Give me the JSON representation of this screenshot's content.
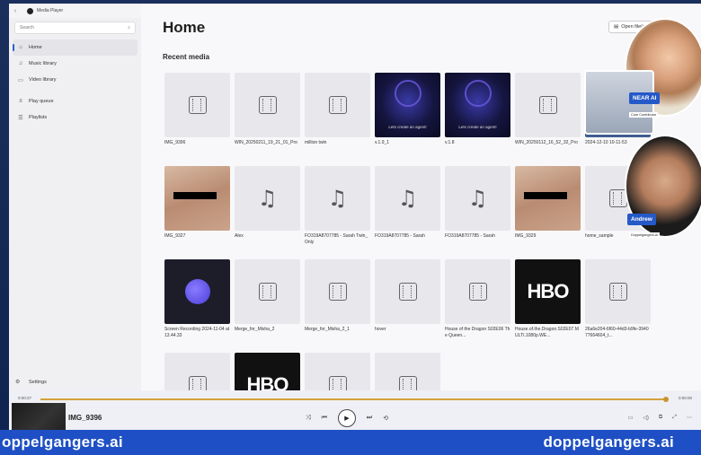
{
  "window": {
    "app_title": "Media Player",
    "back_glyph": "‹",
    "controls": [
      "—",
      "☐",
      "✕"
    ]
  },
  "sidebar": {
    "search_placeholder": "Search",
    "items": [
      {
        "label": "Home",
        "icon": "home-icon",
        "glyph": "⌂",
        "active": true
      },
      {
        "label": "Music library",
        "icon": "music-library-icon",
        "glyph": "♫"
      },
      {
        "label": "Video library",
        "icon": "video-library-icon",
        "glyph": "▭"
      },
      {
        "label": "Play queue",
        "icon": "play-queue-icon",
        "glyph": "≡"
      },
      {
        "label": "Playlists",
        "icon": "playlists-icon",
        "glyph": "☰"
      }
    ],
    "settings_label": "Settings"
  },
  "main": {
    "title": "Home",
    "open_file_label": "Open file(s)",
    "section_title": "Recent media",
    "tiles": [
      {
        "name": "IMG_9396",
        "thumb": "film"
      },
      {
        "name": "WIN_20250211_19_21_01_Pro",
        "thumb": "film"
      },
      {
        "name": "million twin",
        "thumb": "film"
      },
      {
        "name": "v.1.9_1",
        "thumb": "agent",
        "overlay": "Lets create an agent!"
      },
      {
        "name": "v.1.8",
        "thumb": "agent",
        "overlay": "Lets create an agent!"
      },
      {
        "name": "WIN_20250112_16_52_32_Pro",
        "thumb": "film"
      },
      {
        "name": "2024-12-10 10-11-53",
        "thumb": "person",
        "overlay": "Core Contributor"
      },
      {
        "name": "IMG_9327",
        "thumb": "censored"
      },
      {
        "name": "Alex",
        "thumb": "music"
      },
      {
        "name": "FO319A8707785 - Sarah Twin_Only",
        "thumb": "music"
      },
      {
        "name": "FO319A8707785 - Sarah",
        "thumb": "music"
      },
      {
        "name": "FO319A8707785 - Sarah",
        "thumb": "music"
      },
      {
        "name": "IMG_9329",
        "thumb": "censored"
      },
      {
        "name": "home_sample",
        "thumb": "film"
      },
      {
        "name": "Screen Recording 2024-11-04 at 13.44.33",
        "thumb": "circle"
      },
      {
        "name": "Merge_for_Misha_2",
        "thumb": "film"
      },
      {
        "name": "Merge_for_Misha_2_1",
        "thumb": "film"
      },
      {
        "name": "hover",
        "thumb": "film"
      },
      {
        "name": "House of the Dragon S02E06 The Queen...",
        "thumb": "film"
      },
      {
        "name": "House.of.the.Dragon.S02E07.MULTI.1080p.WE...",
        "thumb": "hbo",
        "overlay": "HBO"
      },
      {
        "name": "26a6e204-6f60-44d3-b9fe-394077664604_t...",
        "thumb": "film"
      },
      {
        "name": "",
        "thumb": "film"
      },
      {
        "name": "",
        "thumb": "hbo",
        "overlay": "HBO"
      },
      {
        "name": "",
        "thumb": "film"
      },
      {
        "name": "",
        "thumb": "film"
      }
    ]
  },
  "player": {
    "time_elapsed": "0:00:27",
    "time_total": "0:00:00",
    "progress": 0.995,
    "now_playing": "IMG_9396",
    "controls": [
      {
        "name": "shuffle-icon",
        "glyph": "⤨"
      },
      {
        "name": "previous-icon",
        "glyph": "⏮"
      },
      {
        "name": "play-icon",
        "glyph": "▶"
      },
      {
        "name": "next-icon",
        "glyph": "⏭"
      },
      {
        "name": "repeat-icon",
        "glyph": "⟲"
      }
    ],
    "right_controls": [
      {
        "name": "miniplayer-icon",
        "glyph": "▭"
      },
      {
        "name": "volume-icon",
        "glyph": "◁)"
      },
      {
        "name": "cast-icon",
        "glyph": "⧉"
      },
      {
        "name": "fullscreen-icon",
        "glyph": "⤢"
      },
      {
        "name": "more-icon",
        "glyph": "⋯"
      }
    ]
  },
  "call_overlay": {
    "participant1_tag": "NEAR AI",
    "participant1_sub": "Core Contributor",
    "participant2_tag": "Andrew",
    "participant2_sub": "Doppelgangers.AI"
  },
  "banner": {
    "left_text": "oppelgangers.ai",
    "right_text": "doppelgangers.ai"
  }
}
